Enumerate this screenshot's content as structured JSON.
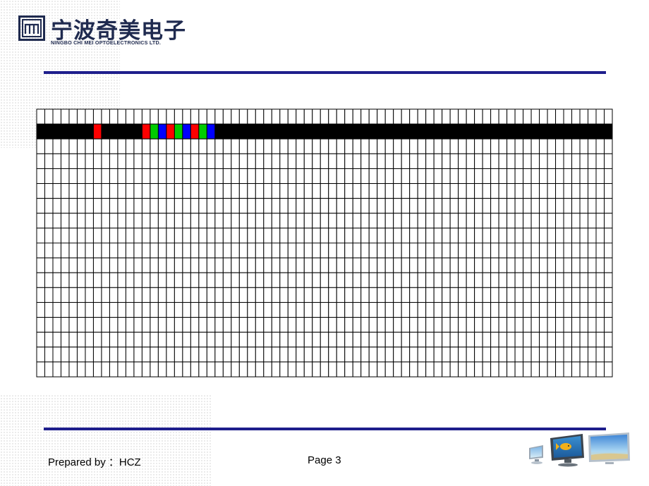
{
  "header": {
    "company_name_cn": "宁波奇美电子",
    "company_name_en": "NINGBO CHI MEI OPTOELECTRONICS LTD."
  },
  "footer": {
    "prepared_by": "Prepared by ：HCZ",
    "page_label": "Page 3"
  },
  "pixel_grid": {
    "columns": 71,
    "rows": 18,
    "highlight_row": 2,
    "base_highlight_color": "#000000",
    "empty_cell_color": "#ffffff",
    "line_color": "#000000",
    "colored_cells": [
      {
        "col": 7,
        "color": "#ff0000"
      },
      {
        "col": 13,
        "color": "#ff0000"
      },
      {
        "col": 14,
        "color": "#00cc00"
      },
      {
        "col": 15,
        "color": "#0000ff"
      },
      {
        "col": 16,
        "color": "#ff0000"
      },
      {
        "col": 17,
        "color": "#00cc00"
      },
      {
        "col": 18,
        "color": "#0000ff"
      },
      {
        "col": 19,
        "color": "#ff0000"
      },
      {
        "col": 20,
        "color": "#00cc00"
      },
      {
        "col": 21,
        "color": "#0000ff"
      }
    ]
  },
  "colors": {
    "rule": "#1e1e8c",
    "brand_text": "#1f2a4f"
  }
}
